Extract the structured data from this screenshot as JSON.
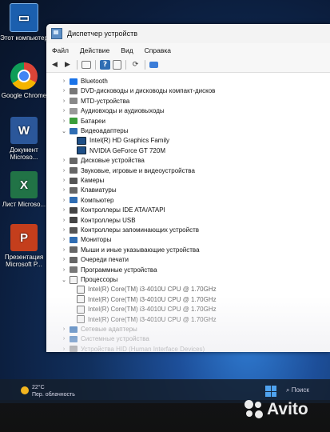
{
  "desktop": {
    "icons": [
      {
        "label": "Этот компьютер",
        "icon": "computer-icon"
      },
      {
        "label": "Google Chrome",
        "icon": "chrome-icon"
      },
      {
        "label": "Документ Microso...",
        "icon": "word-icon"
      },
      {
        "label": "Лист Microso...",
        "icon": "excel-icon"
      },
      {
        "label": "Презентация Microsoft P...",
        "icon": "powerpoint-icon"
      }
    ]
  },
  "window": {
    "title": "Диспетчер устройств",
    "menu": [
      "Файл",
      "Действие",
      "Вид",
      "Справка"
    ],
    "toolbar_icons": [
      "back-icon",
      "forward-icon",
      "properties-icon",
      "help-icon",
      "scan-icon",
      "monitor-icon"
    ]
  },
  "tree": [
    {
      "label": "Bluetooth",
      "level": 1,
      "expanded": false,
      "icon": "bluetooth-icon"
    },
    {
      "label": "DVD-дисководы и дисководы компакт-дисков",
      "level": 1,
      "expanded": false,
      "icon": "dvd-icon"
    },
    {
      "label": "MTD-устройства",
      "level": 1,
      "expanded": false,
      "icon": "device-icon"
    },
    {
      "label": "Аудиовходы и аудиовыходы",
      "level": 1,
      "expanded": false,
      "icon": "audio-icon"
    },
    {
      "label": "Батареи",
      "level": 1,
      "expanded": false,
      "icon": "battery-icon"
    },
    {
      "label": "Видеоадаптеры",
      "level": 1,
      "expanded": true,
      "icon": "display-adapter-icon"
    },
    {
      "label": "Intel(R) HD Graphics Family",
      "level": 2,
      "icon": "display-adapter-icon"
    },
    {
      "label": "NVIDIA GeForce GT 720M",
      "level": 2,
      "icon": "display-adapter-icon"
    },
    {
      "label": "Дисковые устройства",
      "level": 1,
      "expanded": false,
      "icon": "disk-icon"
    },
    {
      "label": "Звуковые, игровые и видеоустройства",
      "level": 1,
      "expanded": false,
      "icon": "sound-icon"
    },
    {
      "label": "Камеры",
      "level": 1,
      "expanded": false,
      "icon": "camera-icon"
    },
    {
      "label": "Клавиатуры",
      "level": 1,
      "expanded": false,
      "icon": "keyboard-icon"
    },
    {
      "label": "Компьютер",
      "level": 1,
      "expanded": false,
      "icon": "computer-icon"
    },
    {
      "label": "Контроллеры IDE ATA/ATAPI",
      "level": 1,
      "expanded": false,
      "icon": "controller-icon"
    },
    {
      "label": "Контроллеры USB",
      "level": 1,
      "expanded": false,
      "icon": "usb-icon"
    },
    {
      "label": "Контроллеры запоминающих устройств",
      "level": 1,
      "expanded": false,
      "icon": "storage-icon"
    },
    {
      "label": "Мониторы",
      "level": 1,
      "expanded": false,
      "icon": "monitor-icon"
    },
    {
      "label": "Мыши и иные указывающие устройства",
      "level": 1,
      "expanded": false,
      "icon": "mouse-icon"
    },
    {
      "label": "Очереди печати",
      "level": 1,
      "expanded": false,
      "icon": "printer-icon"
    },
    {
      "label": "Программные устройства",
      "level": 1,
      "expanded": false,
      "icon": "software-icon"
    },
    {
      "label": "Процессоры",
      "level": 1,
      "expanded": true,
      "icon": "cpu-icon"
    },
    {
      "label": "Intel(R) Core(TM) i3-4010U CPU @ 1.70GHz",
      "level": 2,
      "icon": "cpu-icon"
    },
    {
      "label": "Intel(R) Core(TM) i3-4010U CPU @ 1.70GHz",
      "level": 2,
      "icon": "cpu-icon"
    },
    {
      "label": "Intel(R) Core(TM) i3-4010U CPU @ 1.70GHz",
      "level": 2,
      "icon": "cpu-icon"
    },
    {
      "label": "Intel(R) Core(TM) i3-4010U CPU @ 1.70GHz",
      "level": 2,
      "icon": "cpu-icon"
    },
    {
      "label": "Сетевые адаптеры",
      "level": 1,
      "expanded": false,
      "icon": "network-icon"
    },
    {
      "label": "Системные устройства",
      "level": 1,
      "expanded": false,
      "icon": "system-icon"
    },
    {
      "label": "Устройства HID (Human Interface Devices)",
      "level": 1,
      "expanded": false,
      "icon": "hid-icon"
    }
  ],
  "taskbar": {
    "temperature": "22°C",
    "weather_text": "Пер. облачность",
    "search_label": "Поиск"
  },
  "watermark": {
    "text": "Avito"
  },
  "colors": {
    "accent": "#2f6db3",
    "chrome_red": "#db4437",
    "word_blue": "#2b579a",
    "excel_green": "#217346",
    "ppt_orange": "#c43e1c"
  }
}
